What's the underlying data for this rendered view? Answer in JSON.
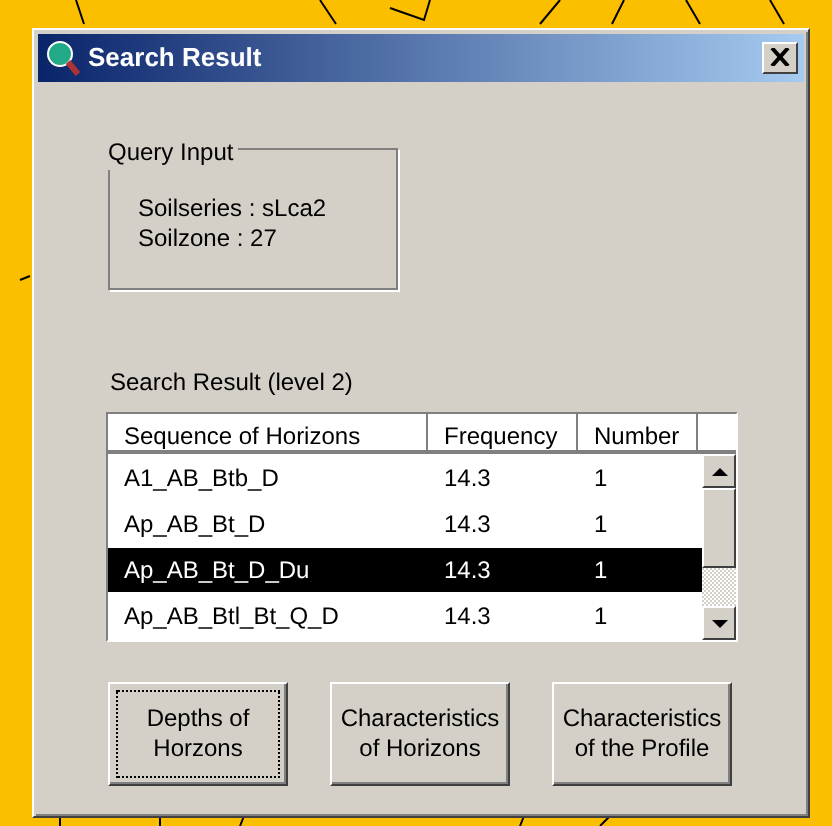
{
  "window": {
    "title": "Search Result"
  },
  "query_input": {
    "legend": "Query Input",
    "lines": [
      "Soilseries :  sLca2",
      "Soilzone : 27"
    ]
  },
  "result": {
    "label": "Search Result (level 2)",
    "columns": [
      "Sequence of Horizons",
      "Frequency",
      "Number"
    ],
    "rows": [
      {
        "cells": [
          "A1_AB_Btb_D",
          "14.3",
          "1"
        ],
        "selected": false
      },
      {
        "cells": [
          "Ap_AB_Bt_D",
          "14.3",
          "1"
        ],
        "selected": false
      },
      {
        "cells": [
          "Ap_AB_Bt_D_Du",
          "14.3",
          "1"
        ],
        "selected": true
      },
      {
        "cells": [
          "Ap_AB_Btl_Bt_Q_D",
          "14.3",
          "1"
        ],
        "selected": false
      }
    ]
  },
  "buttons": [
    {
      "label": "Depths of Horzons",
      "focused": true
    },
    {
      "label": "Characteristics of Horizons",
      "focused": false
    },
    {
      "label": "Characteristics of the Profile",
      "focused": false
    }
  ]
}
